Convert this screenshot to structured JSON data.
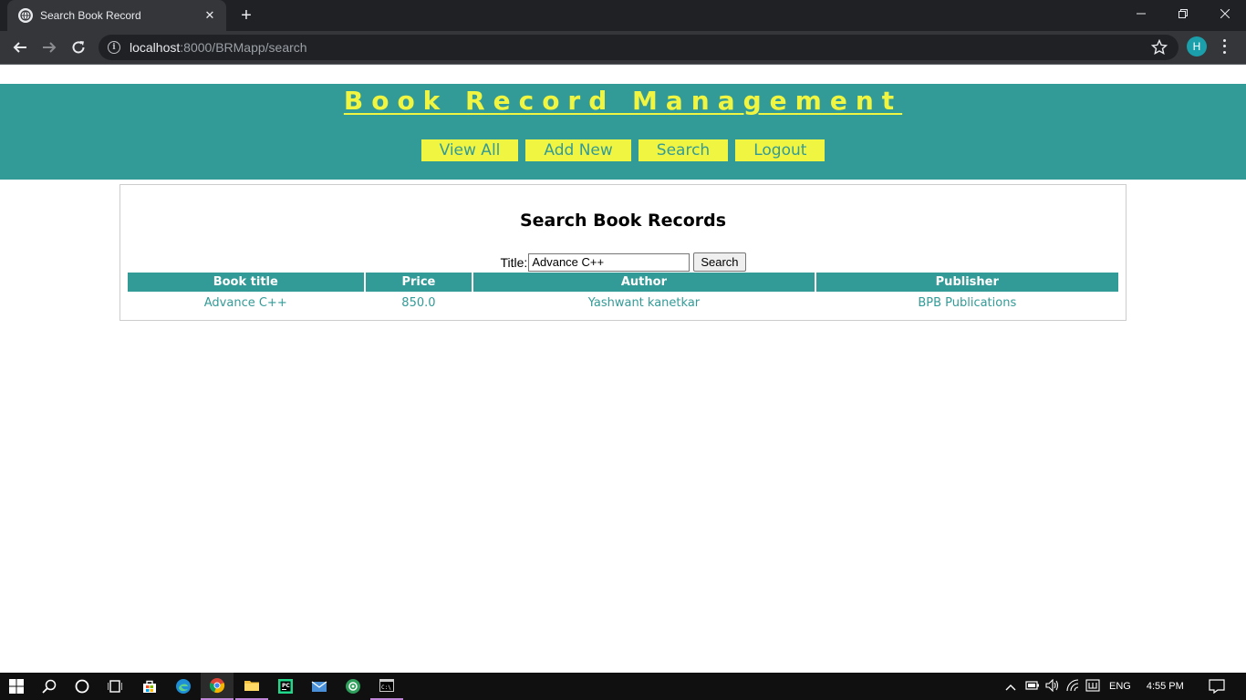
{
  "browser": {
    "tab_title": "Search Book Record",
    "url_host": "localhost",
    "url_rest": ":8000/BRMapp/search",
    "avatar_letter": "H",
    "icons": [
      "globe-icon",
      "close-icon",
      "plus-icon",
      "back-icon",
      "forward-icon",
      "reload-icon",
      "info-icon",
      "star-icon",
      "menu-icon"
    ]
  },
  "site": {
    "title": "Book Record Management",
    "nav": [
      {
        "label": "View All"
      },
      {
        "label": "Add New"
      },
      {
        "label": "Search"
      },
      {
        "label": "Logout"
      }
    ]
  },
  "search_panel": {
    "heading": "Search Book Records",
    "title_label": "Title:",
    "title_value": "Advance C++",
    "button_label": "Search"
  },
  "results": {
    "headers": [
      "Book title",
      "Price",
      "Author",
      "Publisher"
    ],
    "rows": [
      [
        "Advance C++",
        "850.0",
        "Yashwant kanetkar",
        "BPB Publications"
      ]
    ]
  },
  "taskbar": {
    "language": "ENG",
    "time": "4:55 PM",
    "apps": [
      "start-icon",
      "search-icon",
      "cortana-icon",
      "task-view-icon",
      "store-icon",
      "edge-icon",
      "chrome-icon",
      "file-explorer-icon",
      "pycharm-icon",
      "mail-icon",
      "green-app-icon",
      "cmd-icon"
    ]
  },
  "colors": {
    "brand_teal": "#339b97",
    "brand_yellow": "#f0f542"
  }
}
